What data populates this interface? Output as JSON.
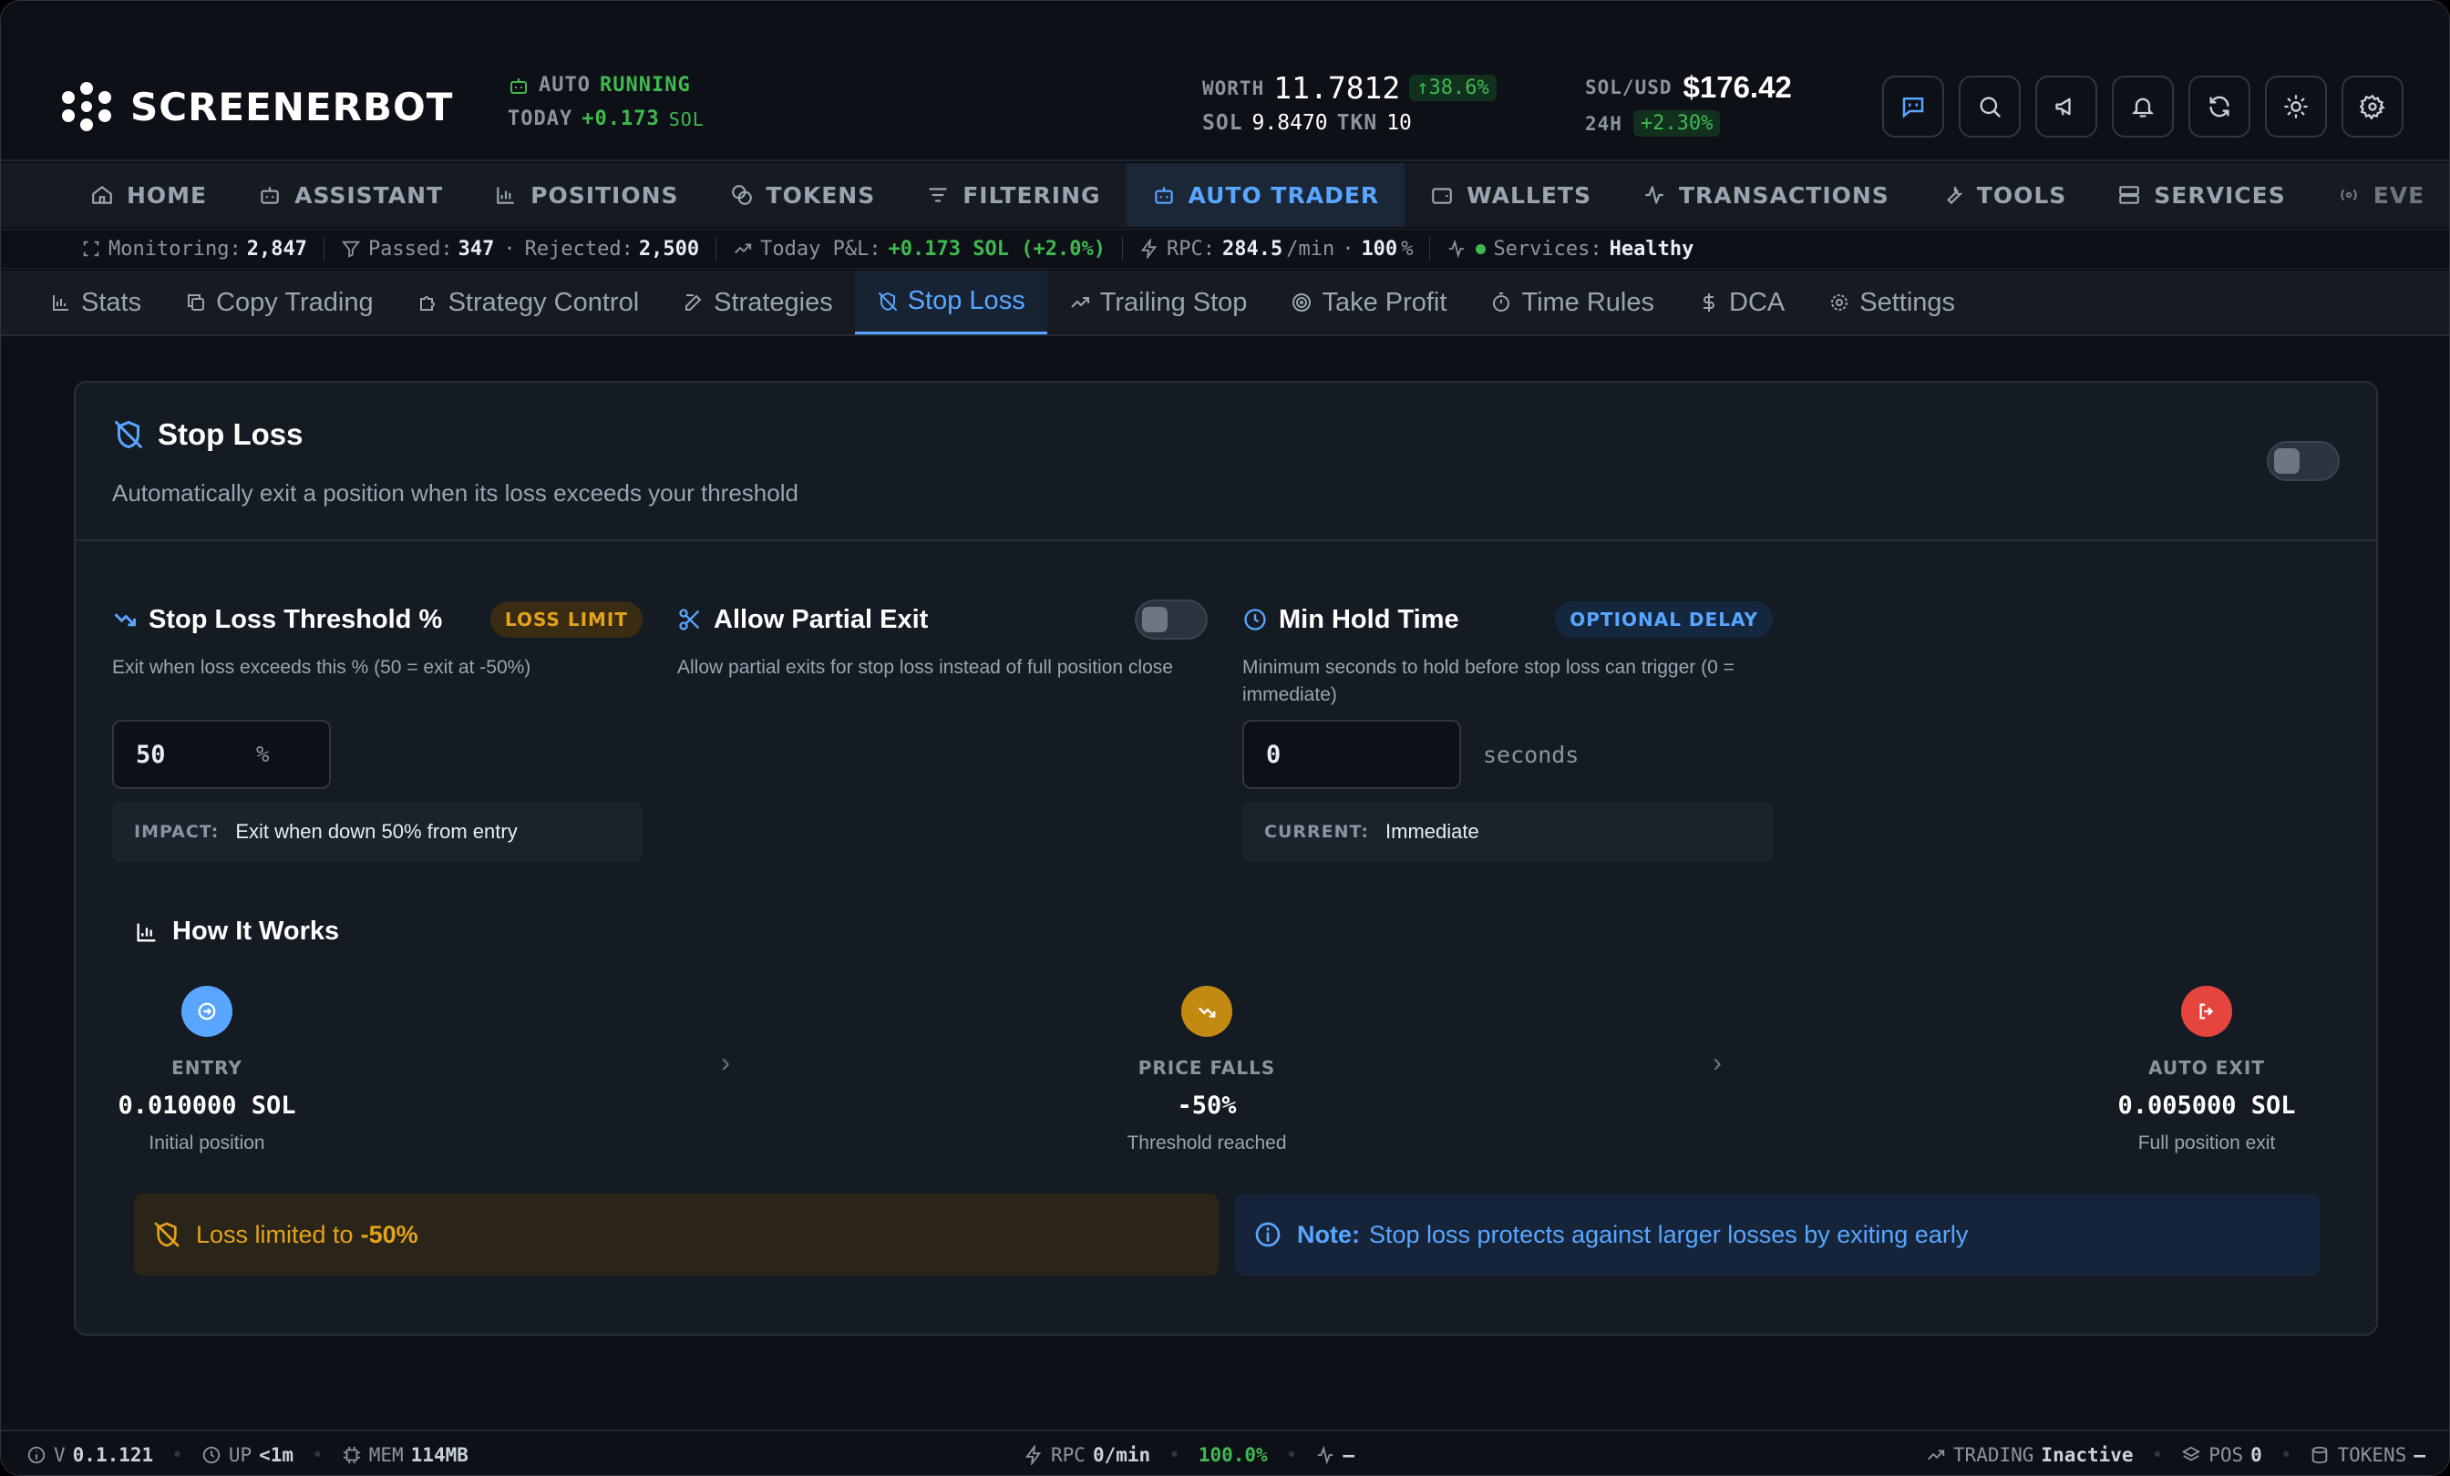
{
  "app": {
    "brand": "SCREENERBOT"
  },
  "header": {
    "auto_label": "AUTO",
    "auto_status": "RUNNING",
    "today_label": "TODAY",
    "today_value": "+0.173",
    "today_unit": "SOL",
    "worth_label": "WORTH",
    "worth_value": "11.7812",
    "worth_change": "↑38.6%",
    "sol_label": "SOL",
    "sol_value": "9.8470",
    "tkn_label": "TKN",
    "tkn_value": "10",
    "pair_label": "SOL/USD",
    "pair_value": "$176.42",
    "h24_label": "24H",
    "h24_change": "+2.30%"
  },
  "header_buttons": [
    {
      "icon": "bot-chat-icon"
    },
    {
      "icon": "search-icon"
    },
    {
      "icon": "megaphone-icon"
    },
    {
      "icon": "bell-icon"
    },
    {
      "icon": "refresh-icon"
    },
    {
      "icon": "sun-icon"
    },
    {
      "icon": "gear-icon"
    }
  ],
  "nav": {
    "items": [
      {
        "label": "HOME",
        "icon": "home-icon"
      },
      {
        "label": "ASSISTANT",
        "icon": "bot-icon"
      },
      {
        "label": "POSITIONS",
        "icon": "chart-icon"
      },
      {
        "label": "TOKENS",
        "icon": "coins-icon"
      },
      {
        "label": "FILTERING",
        "icon": "filter-icon"
      },
      {
        "label": "AUTO TRADER",
        "icon": "bot-icon"
      },
      {
        "label": "WALLETS",
        "icon": "wallet-icon"
      },
      {
        "label": "TRANSACTIONS",
        "icon": "activity-icon"
      },
      {
        "label": "TOOLS",
        "icon": "wrench-icon"
      },
      {
        "label": "SERVICES",
        "icon": "server-icon"
      },
      {
        "label": "EVE",
        "icon": "radio-icon"
      }
    ],
    "active": "AUTO TRADER"
  },
  "statusbar": {
    "monitoring_label": "Monitoring:",
    "monitoring_value": "2,847",
    "passed_label": "Passed:",
    "passed_value": "347",
    "rejected_label": "Rejected:",
    "rejected_value": "2,500",
    "pnl_label": "Today P&L:",
    "pnl_value": "+0.173 SOL (+2.0%)",
    "rpc_label": "RPC:",
    "rpc_value": "284.5",
    "rpc_unit": "/min",
    "rpc_pct": "100",
    "rpc_pct_unit": "%",
    "services_label": "Services:",
    "services_value": "Healthy"
  },
  "subtabs": {
    "items": [
      {
        "label": "Stats",
        "icon": "bar-chart-icon"
      },
      {
        "label": "Copy Trading",
        "icon": "copy-icon"
      },
      {
        "label": "Strategy Control",
        "icon": "puzzle-icon"
      },
      {
        "label": "Strategies",
        "icon": "edit-icon"
      },
      {
        "label": "Stop Loss",
        "icon": "shield-off-icon"
      },
      {
        "label": "Trailing Stop",
        "icon": "trending-up-icon"
      },
      {
        "label": "Take Profit",
        "icon": "target-icon"
      },
      {
        "label": "Time Rules",
        "icon": "timer-icon"
      },
      {
        "label": "DCA",
        "icon": "dollar-icon"
      },
      {
        "label": "Settings",
        "icon": "gear-icon"
      }
    ],
    "active": "Stop Loss"
  },
  "card": {
    "title": "Stop Loss",
    "subtitle": "Automatically exit a position when its loss exceeds your threshold",
    "enabled": false
  },
  "threshold": {
    "title": "Stop Loss Threshold %",
    "pill": "LOSS LIMIT",
    "desc": "Exit when loss exceeds this % (50 = exit at -50%)",
    "value": "50",
    "unit": "%",
    "impact_label": "IMPACT:",
    "impact_text": "Exit when down 50% from entry"
  },
  "partial": {
    "title": "Allow Partial Exit",
    "desc": "Allow partial exits for stop loss instead of full position close",
    "enabled": false
  },
  "hold": {
    "title": "Min Hold Time",
    "pill": "OPTIONAL DELAY",
    "desc": "Minimum seconds to hold before stop loss can trigger (0 = immediate)",
    "value": "0",
    "unit": "seconds",
    "current_label": "CURRENT:",
    "current_text": "Immediate"
  },
  "how": {
    "title": "How It Works",
    "steps": [
      {
        "label": "ENTRY",
        "value": "0.010000 SOL",
        "note": "Initial position",
        "color": "#58a6ff"
      },
      {
        "label": "PRICE FALLS",
        "value": "-50%",
        "note": "Threshold reached",
        "color": "#c38a12"
      },
      {
        "label": "AUTO EXIT",
        "value": "0.005000 SOL",
        "note": "Full position exit",
        "color": "#e5453d"
      }
    ],
    "loss_text": "Loss limited to",
    "loss_value": "-50%",
    "note_label": "Note:",
    "note_text": "Stop loss protects against larger losses by exiting early"
  },
  "footer": {
    "version_label": "V",
    "version": "0.1.121",
    "up_label": "UP",
    "up_value": "<1m",
    "mem_label": "MEM",
    "mem_value": "114MB",
    "rpc_label": "RPC",
    "rpc_value": "0/min",
    "rpc_pct": "100.0%",
    "pulse_value": "–",
    "trading_label": "TRADING",
    "trading_value": "Inactive",
    "pos_label": "POS",
    "pos_value": "0",
    "tokens_label": "TOKENS",
    "tokens_value": "–"
  },
  "colors": {
    "accent": "#58a6ff",
    "positive": "#3fb950",
    "warning": "#e3a21a",
    "danger": "#e5453d",
    "background": "#0d1117"
  }
}
